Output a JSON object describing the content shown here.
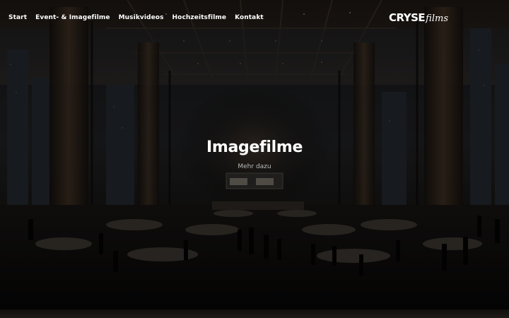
{
  "nav": {
    "items": [
      {
        "label": "Start"
      },
      {
        "label": "Event- & Imagefilme"
      },
      {
        "label": "Musikvideos"
      },
      {
        "label": "Hochzeitsfilme"
      },
      {
        "label": "Kontakt"
      }
    ]
  },
  "logo": {
    "part1": "CRYSE",
    "part2": "films"
  },
  "hero": {
    "title": "Imagefilme",
    "link": "Mehr dazu"
  },
  "colors": {
    "background": "#0b0a09",
    "text": "#ffffff",
    "subtext": "#bbbbbb"
  }
}
